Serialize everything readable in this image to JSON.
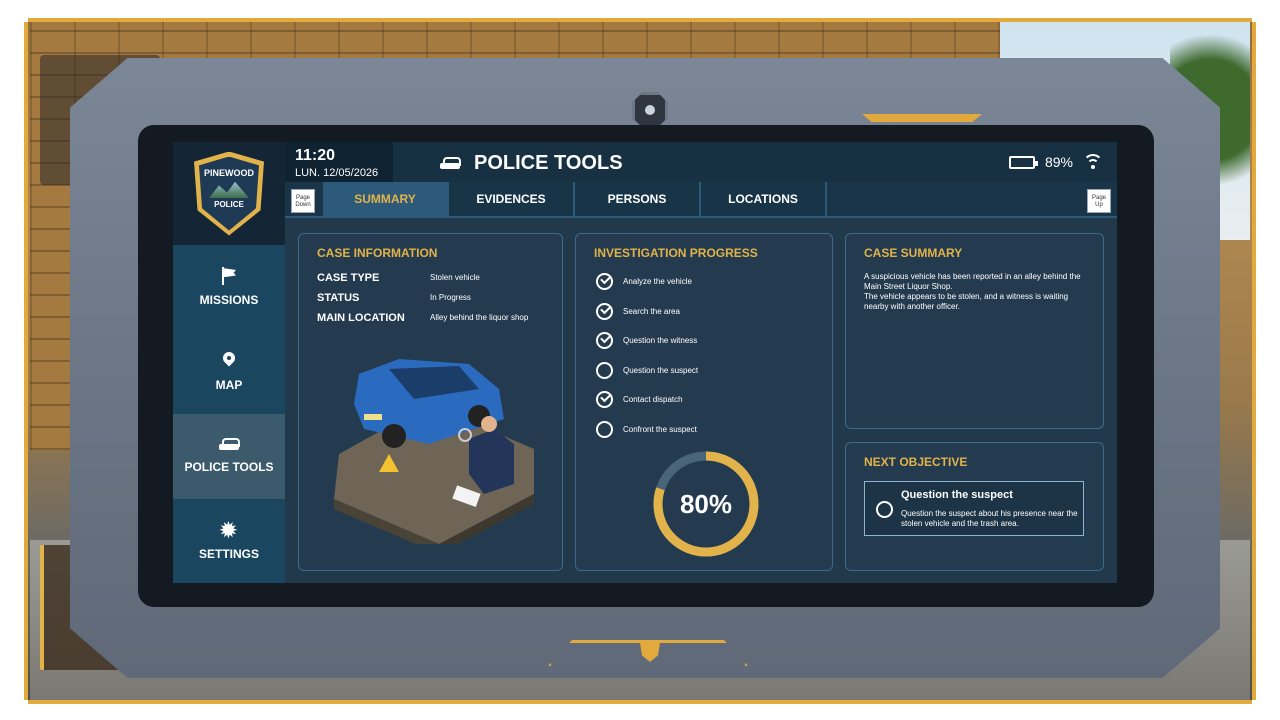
{
  "status": {
    "time": "11:20",
    "date": "LUN. 12/05/2026",
    "battery": "89%",
    "battery_level": 0.89
  },
  "app": {
    "title": "POLICE TOOLS",
    "icon": "car-icon"
  },
  "badge": {
    "top_text": "PINEWOOD",
    "bottom_text": "POLICE"
  },
  "tabbar": {
    "page_down": "Page Down",
    "page_up": "Page Up",
    "tabs": [
      {
        "label": "SUMMARY",
        "active": true
      },
      {
        "label": "EVIDENCES",
        "active": false
      },
      {
        "label": "PERSONS",
        "active": false
      },
      {
        "label": "LOCATIONS",
        "active": false
      }
    ]
  },
  "sidebar": {
    "items": [
      {
        "label": "MISSIONS",
        "icon": "flag-icon",
        "active": false
      },
      {
        "label": "MAP",
        "icon": "map-pin-icon",
        "active": false
      },
      {
        "label": "POLICE TOOLS",
        "icon": "car-icon",
        "active": true
      },
      {
        "label": "SETTINGS",
        "icon": "gear-icon",
        "active": false
      }
    ]
  },
  "case_information": {
    "title": "CASE INFORMATION",
    "rows": [
      {
        "key": "CASE TYPE",
        "value": "Stolen vehicle"
      },
      {
        "key": "STATUS",
        "value": "In Progress"
      },
      {
        "key": "MAIN LOCATION",
        "value": "Alley behind the liquor shop"
      }
    ]
  },
  "investigation_progress": {
    "title": "INVESTIGATION PROGRESS",
    "tasks": [
      {
        "label": "Analyze the vehicle",
        "done": true
      },
      {
        "label": "Search the area",
        "done": true
      },
      {
        "label": "Question the witness",
        "done": true
      },
      {
        "label": "Question the suspect",
        "done": false
      },
      {
        "label": "Contact dispatch",
        "done": true
      },
      {
        "label": "Confront the suspect",
        "done": false
      }
    ],
    "percent_label": "80%",
    "percent": 80,
    "ring_color": "#e2b34a",
    "track_color": "#4a6578"
  },
  "case_summary": {
    "title": "CASE SUMMARY",
    "line1": "A suspicious vehicle has been reported in an alley behind the Main Street Liquor Shop.",
    "line2": "The vehicle appears to be stolen, and a witness is waiting nearby with another officer."
  },
  "next_objective": {
    "title": "NEXT OBJECTIVE",
    "objective_title": "Question the suspect",
    "objective_desc": "Question the suspect about his presence near the stolen vehicle and the trash area."
  },
  "colors": {
    "accent": "#e2b34a",
    "panel_border": "#3d6a8a"
  }
}
